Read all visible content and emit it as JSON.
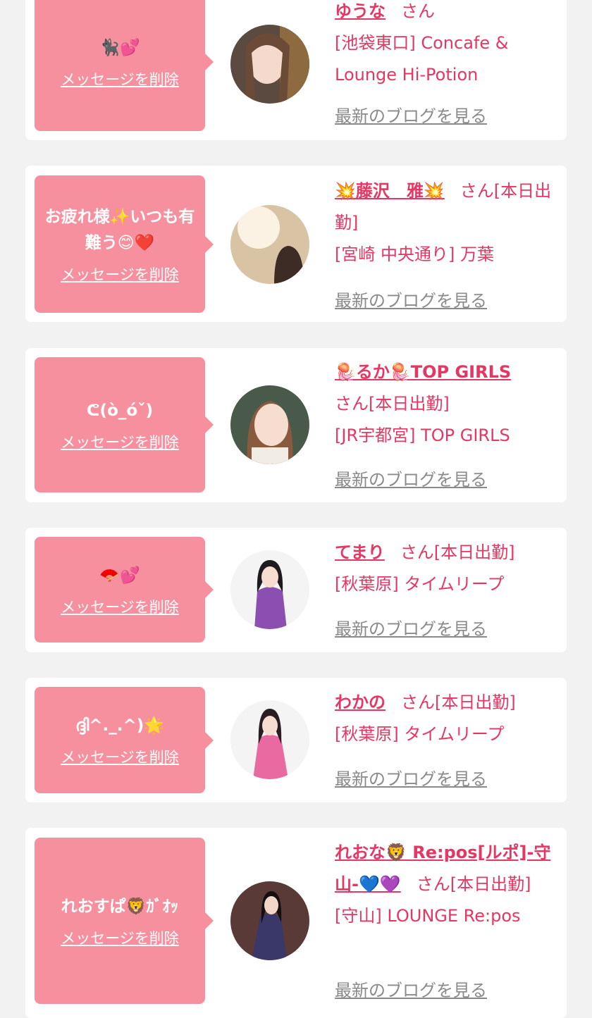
{
  "cards": [
    {
      "message": "🐈‍⬛💕",
      "delete_label": "メッセージを削除",
      "name": "ゆうな",
      "honorific": "さん",
      "shop": "[池袋東口] Concafe & Lounge Hi-Potion",
      "blog_label": "最新のブログを見る"
    },
    {
      "message": "お疲れ様✨いつも有難う😊❤️",
      "delete_label": "メッセージを削除",
      "name": "💥藤沢　雅💥",
      "honorific": "さん[本日出勤]",
      "shop": "[宮崎 中央通り] 万葉",
      "blog_label": "最新のブログを見る"
    },
    {
      "message": "ᕦ(ò_óˇ)",
      "delete_label": "メッセージを削除",
      "name": "🪼るか🪼TOP GIRLS",
      "honorific": "さん[本日出勤]",
      "shop": "[JR宇都宮] TOP GIRLS",
      "blog_label": "最新のブログを見る"
    },
    {
      "message": "🪭💕",
      "delete_label": "メッセージを削除",
      "name": "てまり",
      "honorific": "さん[本日出勤]",
      "shop": "[秋葉原] タイムリープ",
      "blog_label": "最新のブログを見る"
    },
    {
      "message": "ദ്ദി^._.^)🌟",
      "delete_label": "メッセージを削除",
      "name": "わかの",
      "honorific": "さん[本日出勤]",
      "shop": "[秋葉原] タイムリープ",
      "blog_label": "最新のブログを見る"
    },
    {
      "message": "れおすぱ🦁ｶﾞｵｯ",
      "delete_label": "メッセージを削除",
      "name": "れおな🦁 Re:pos[ルポ]-守山-💙💜",
      "honorific": "さん[本日出勤]",
      "shop": "[守山] LOUNGE Re:pos",
      "blog_label": "最新のブログを見る"
    }
  ]
}
